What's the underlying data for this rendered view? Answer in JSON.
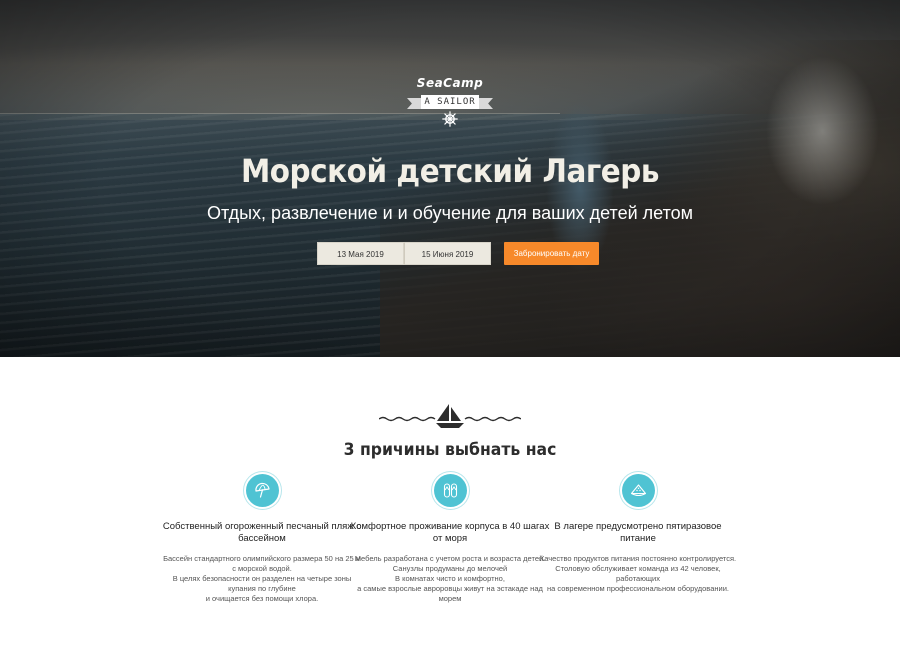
{
  "hero": {
    "logo": {
      "brand": "SeaCamp",
      "ribbon": "A SAILOR"
    },
    "title": "Морской детский Лагерь",
    "subtitle": "Отдых, развлечение и и обучение для ваших детей летом",
    "date_start": "13 Мая 2019",
    "date_end": "15 Июня 2019",
    "book_button": "Забронировать дату"
  },
  "features_section": {
    "title": "3 причины выбнать нас",
    "items": [
      {
        "icon": "beach-umbrella-icon",
        "title": "Собственный огороженный песчаный пляж с бассейном",
        "body": "Бассейн стандартного олимпийского размера 50 на 25 м  с морской водой.\nВ целях безопасности он разделен на четыре зоны купания по глубине\nи очищается без помощи хлора."
      },
      {
        "icon": "flip-flops-icon",
        "title": "Комфортное проживание корпуса в 40 шагах от моря",
        "body": "Мебель разработана с учетом роста и возраста детей.  Санузлы продуманы до мелочей\nВ комнатах чисто и комфортно,\nа самые взрослые авроровцы живут на эстакаде над морем"
      },
      {
        "icon": "watermelon-icon",
        "title": "В лагере предусмотрено пятиразовое питание",
        "body": "Качество продуктов питания постоянно контролируется. Столовую обслуживает команда из 42 человек, работающих\nна современном профессиональном оборудовании."
      }
    ]
  },
  "colors": {
    "accent": "#f7892a",
    "icon_circle": "#4fc3d3",
    "date_box": "#ece9e0"
  }
}
